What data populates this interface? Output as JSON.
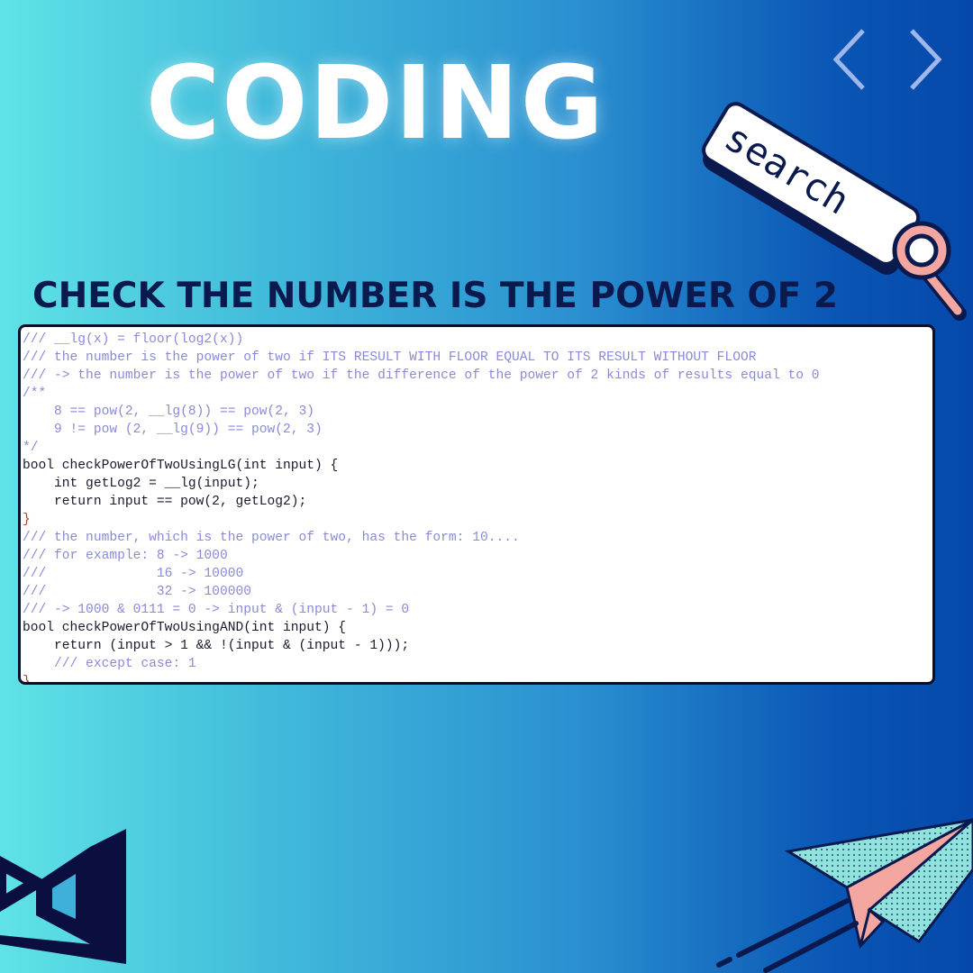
{
  "header": {
    "title": "CODING",
    "subtitle": "CHECK THE NUMBER IS THE POWER OF 2"
  },
  "search_widget": {
    "label": "search"
  },
  "code_lines": [
    "/// __lg(x) = floor(log2(x))",
    "/// the number is the power of two if ITS RESULT WITH FLOOR EQUAL TO ITS RESULT WITHOUT FLOOR",
    "/// -> the number is the power of two if the difference of the power of 2 kinds of results equal to 0",
    "/**",
    "    8 == pow(2, __lg(8)) == pow(2, 3)",
    "    9 != pow (2, __lg(9)) == pow(2, 3)",
    "*/",
    "bool checkPowerOfTwoUsingLG(int input) {",
    "    int getLog2 = __lg(input);",
    "    return input == pow(2, getLog2);",
    "}",
    "/// the number, which is the power of two, has the form: 10....",
    "/// for example: 8 -> 1000",
    "///              16 -> 10000",
    "///              32 -> 100000",
    "/// -> 1000 & 0111 = 0 -> input & (input - 1) = 0",
    "bool checkPowerOfTwoUsingAND(int input) {",
    "    return (input > 1 && !(input & (input - 1)));",
    "    /// except case: 1",
    "}"
  ],
  "icons": {
    "code_brackets": "chevron-brackets-icon",
    "magnifier": "magnifier-icon",
    "logo": "visual-studio-logo",
    "paper_plane": "paper-plane-icon"
  },
  "colors": {
    "title": "#ffffff",
    "subtitle": "#0b1a4e",
    "comment": "#8a8ad8",
    "keyword": "#1a1a7a",
    "punct": "#d43030",
    "plane_teal": "#8fe3dc",
    "plane_pink": "#f4a6a0"
  }
}
